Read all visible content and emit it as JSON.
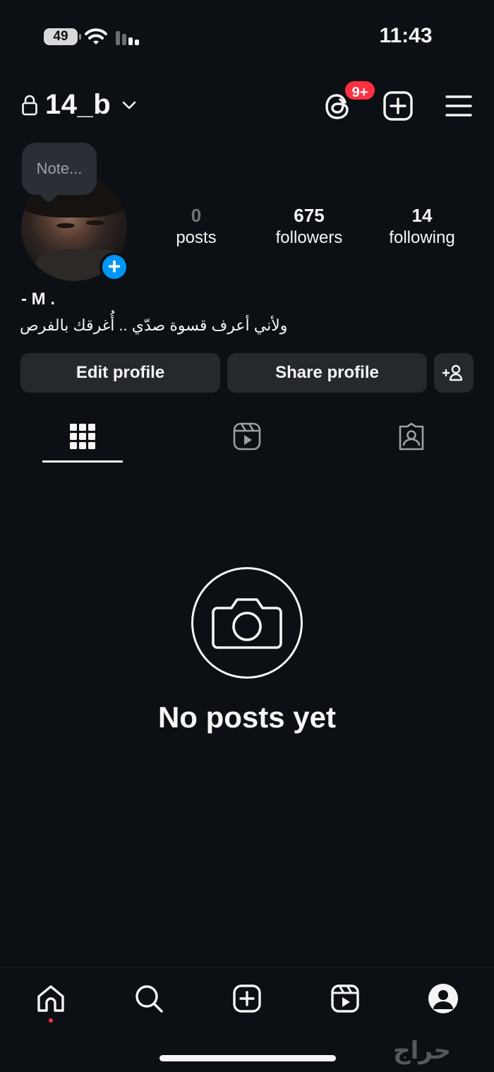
{
  "status_bar": {
    "battery": "49",
    "time": "11:43"
  },
  "header": {
    "username": "14_b",
    "threads_badge": "9+"
  },
  "note": {
    "placeholder": "Note..."
  },
  "stats": [
    {
      "value": "0",
      "label": "posts"
    },
    {
      "value": "675",
      "label": "followers"
    },
    {
      "value": "14",
      "label": "following"
    }
  ],
  "bio": {
    "name": "- M .",
    "text": "ولأني أعرف قسوة صدّي .. أُغرقك بالفرص"
  },
  "buttons": {
    "edit": "Edit profile",
    "share": "Share profile"
  },
  "empty_state": {
    "text": "No posts yet"
  },
  "watermark": "حراج",
  "colors": {
    "background": "#0c1014",
    "badge": "#ff3040",
    "accent": "#0095f6",
    "button": "#25292e"
  },
  "icons": {
    "header": [
      "lock-icon",
      "chevron-down-icon",
      "threads-icon",
      "new-post-icon",
      "menu-icon"
    ],
    "tabs": [
      "grid-icon",
      "reels-icon",
      "tagged-icon"
    ],
    "nav": [
      "home-icon",
      "search-icon",
      "create-icon",
      "reels-icon",
      "profile-icon"
    ]
  }
}
